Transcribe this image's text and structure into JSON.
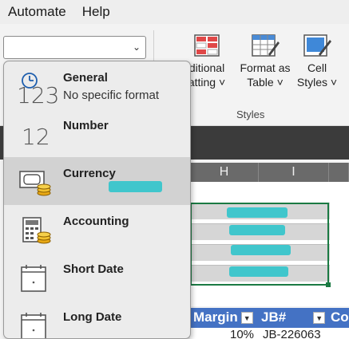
{
  "menubar": {
    "items": [
      "Automate",
      "Help"
    ]
  },
  "ribbon": {
    "number_format_value": "",
    "buttons": {
      "conditional_formatting": {
        "line1": "ditional",
        "line2": "atting ˅"
      },
      "format_as_table": {
        "line1": "Format as",
        "line2": "Table ˅"
      },
      "cell_styles": {
        "line1": "Cell",
        "line2": "Styles ˅"
      }
    },
    "group_label": "Styles"
  },
  "columns": [
    "H",
    "I"
  ],
  "table": {
    "headers": [
      "Margin",
      "JB#",
      "Co"
    ],
    "first_row": {
      "margin": "10%",
      "jb": "JB-226063"
    }
  },
  "dropdown": {
    "options": [
      {
        "title": "General",
        "subtitle": "No specific format",
        "icon": "general-123-icon",
        "big": "123"
      },
      {
        "title": "Number",
        "subtitle": "",
        "icon": "number-12-icon",
        "big": "12"
      },
      {
        "title": "Currency",
        "subtitle": "",
        "icon": "currency-icon"
      },
      {
        "title": "Accounting",
        "subtitle": "",
        "icon": "accounting-icon"
      },
      {
        "title": "Short Date",
        "subtitle": "",
        "icon": "short-date-icon"
      },
      {
        "title": "Long Date",
        "subtitle": "",
        "icon": "long-date-icon"
      }
    ],
    "selected_index": 2
  },
  "colors": {
    "accent_green": "#1b7a43",
    "table_header": "#4472c4",
    "redaction": "#40c6cc"
  }
}
